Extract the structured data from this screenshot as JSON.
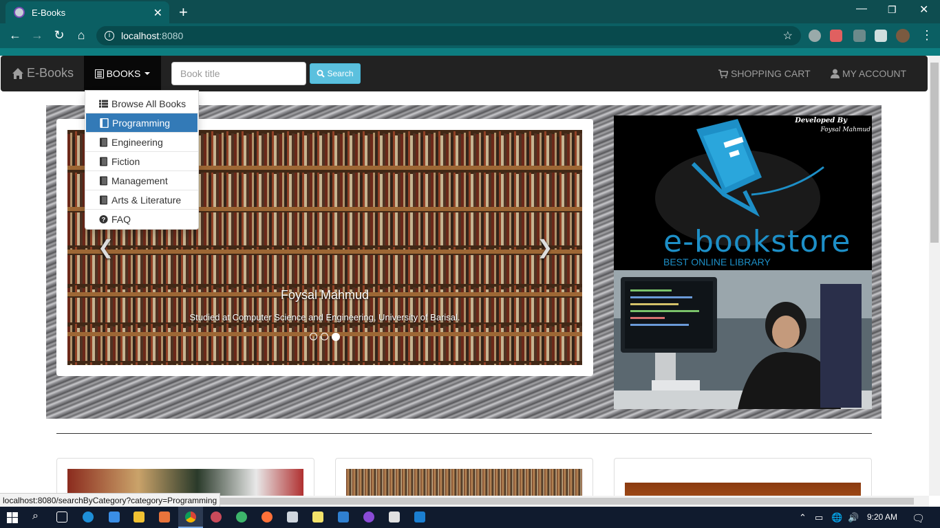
{
  "browser": {
    "tab_title": "E-Books",
    "url_host": "localhost",
    "url_port": ":8080"
  },
  "navbar": {
    "brand": "E-Books",
    "books_menu": "BOOKS",
    "search_placeholder": "Book title",
    "search_button": "Search",
    "cart": "SHOPPING CART",
    "account": "MY ACCOUNT"
  },
  "dropdown": {
    "items": [
      {
        "label": "Browse All Books",
        "icon": "list-icon"
      },
      {
        "label": "Programming",
        "icon": "book-icon",
        "active": true
      },
      {
        "label": "Engineering",
        "icon": "book-icon"
      },
      {
        "label": "Fiction",
        "icon": "book-icon"
      },
      {
        "label": "Management",
        "icon": "book-icon"
      },
      {
        "label": "Arts & Literature",
        "icon": "book-icon"
      },
      {
        "label": "FAQ",
        "icon": "question-circle-icon"
      }
    ]
  },
  "carousel": {
    "caption_title": "Foysal Mahmud",
    "caption_text": "Studied at Computer Science and Engineering, University of Barisal.",
    "slide_count": 3,
    "active_slide": 3
  },
  "promo": {
    "developed_by": "Developed By",
    "developer_name": "Foysal Mahmud",
    "logo_text": "e-bookstore",
    "logo_subtitle": "BEST ONLINE LIBRARY"
  },
  "statusbar": {
    "link": "localhost:8080/searchByCategory?category=Programming"
  },
  "taskbar": {
    "time": "9:20 AM"
  },
  "colors": {
    "chrome_frame": "#0e4d50",
    "navbar_bg": "#222222",
    "dropdown_active": "#337ab7",
    "search_button": "#5bc0de"
  }
}
